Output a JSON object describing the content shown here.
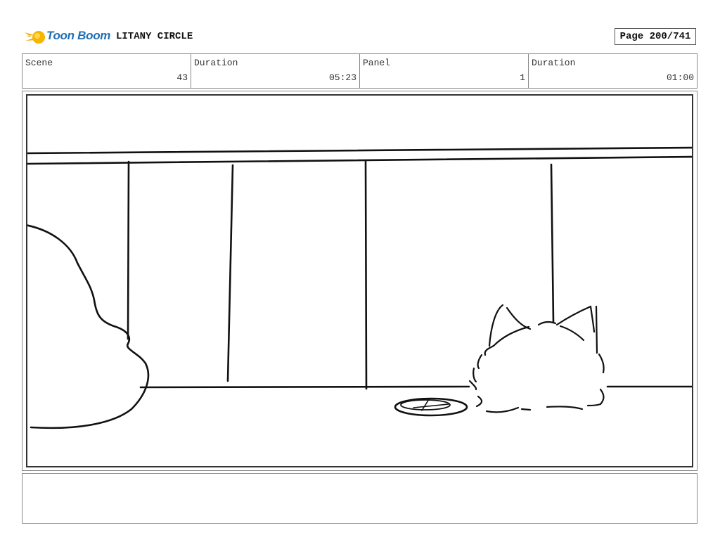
{
  "header": {
    "logo_text": "Toon Boom",
    "project_title": "LITANY CIRCLE",
    "page_label": "Page 200/741"
  },
  "info": [
    {
      "label": "Scene",
      "value": "43"
    },
    {
      "label": "Duration",
      "value": "05:23"
    },
    {
      "label": "Panel",
      "value": "1"
    },
    {
      "label": "Duration",
      "value": "01:00"
    }
  ],
  "panel": {
    "image_subject": "line sketch of a room: wall molding, wall panel lines, floor line, a foreground silhouette, a dish on the floor and a fluffy cat peeking from behind",
    "icons": [
      "toon-boom-logo"
    ]
  },
  "notes": {
    "text": ""
  },
  "colors": {
    "logo_orange": "#f5a400",
    "logo_blue": "#1f6fb4",
    "border": "#888888"
  }
}
